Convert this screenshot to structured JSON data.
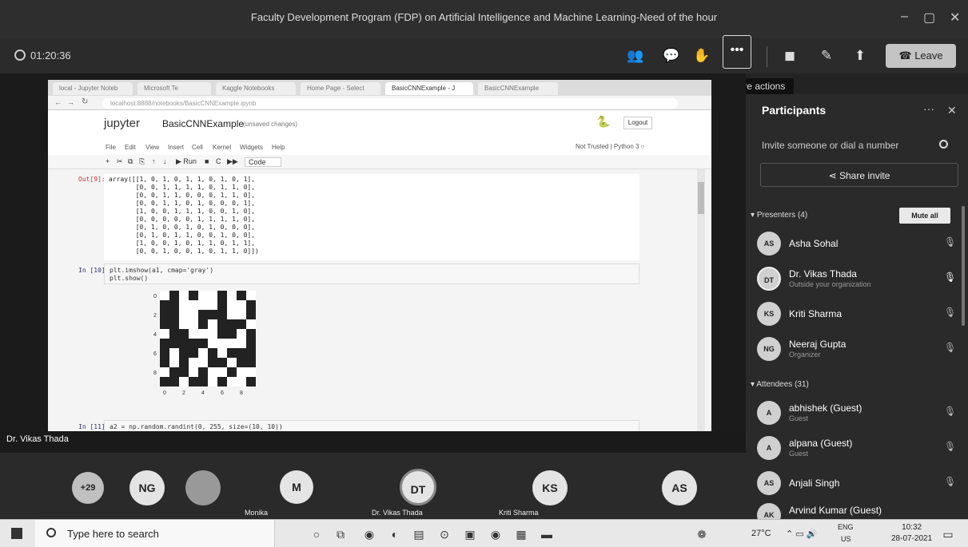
{
  "window": {
    "title": "Faculty Development Program (FDP) on Artificial Intelligence and Machine Learning-Need of the hour"
  },
  "meeting": {
    "timer": "01:20:36",
    "more_actions_tooltip": "More actions",
    "more_label": "•••",
    "leave_label": "Leave"
  },
  "browser": {
    "tabs": [
      "local - Jupyter Noteb",
      "Microsoft Te",
      "Kaggle Notebooks",
      "Home Page - Select",
      "BasicCNNExample - J",
      "BasicCNNExample"
    ],
    "url": "localhost:8888/notebooks/BasicCNNExample.ipynb",
    "notebook_name": "BasicCNNExample",
    "jupyter_label": "jupyter",
    "saved_state": "(unsaved changes)",
    "logout_label": "Logout",
    "menus": [
      "File",
      "Edit",
      "View",
      "Insert",
      "Cell",
      "Kernel",
      "Widgets",
      "Help"
    ],
    "kernel_info": "Not Trusted   |  Python 3 ○",
    "toolbar": [
      "+",
      "✂",
      "⧉",
      "⎘",
      "↑",
      "↓",
      "▶ Run",
      "■",
      "C",
      "▶▶",
      "Code"
    ],
    "out_prompt": "Out[9]:",
    "array_text": "array([[1, 0, 1, 0, 1, 1, 0, 1, 0, 1],\n       [0, 0, 1, 1, 1, 1, 0, 1, 1, 0],\n       [0, 0, 1, 1, 0, 0, 0, 1, 1, 0],\n       [0, 0, 1, 1, 0, 1, 0, 0, 0, 1],\n       [1, 0, 0, 1, 1, 1, 0, 0, 1, 0],\n       [0, 0, 0, 0, 0, 1, 1, 1, 1, 0],\n       [0, 1, 0, 0, 1, 0, 1, 0, 0, 0],\n       [0, 1, 0, 1, 1, 0, 0, 1, 0, 0],\n       [1, 0, 0, 1, 0, 1, 1, 0, 1, 1],\n       [0, 0, 1, 0, 0, 1, 0, 1, 1, 0]])",
    "in_prompt": "In [10]:",
    "code_cell": "plt.imshow(a1, cmap='gray')\nplt.show()",
    "in_prompt2": "In [11]:",
    "code_cell2": "a2 = np.random.randint(0, 255, size=(10, 10))",
    "image_ticks_x": [
      "0",
      "2",
      "4",
      "6",
      "8"
    ],
    "image_ticks_y": [
      "0",
      "2",
      "4",
      "6",
      "8"
    ]
  },
  "presenter_video_label": "Dr. Vikas Thada",
  "participants": {
    "title": "Participants",
    "invite_placeholder": "Invite someone or dial a number",
    "share_invite": "Share invite",
    "presenters_header": "Presenters (4)",
    "mute_all": "Mute all",
    "presenters": [
      {
        "initials": "AS",
        "name": "Asha Sohal",
        "sub": ""
      },
      {
        "initials": "DT",
        "name": "Dr. Vikas Thada",
        "sub": "Outside your organization"
      },
      {
        "initials": "KS",
        "name": "Kriti Sharma",
        "sub": ""
      },
      {
        "initials": "NG",
        "name": "Neeraj Gupta",
        "sub": "Organizer"
      }
    ],
    "attendees_header": "Attendees (31)",
    "attendees": [
      {
        "initials": "A",
        "name": "abhishek (Guest)",
        "sub": "Guest"
      },
      {
        "initials": "A",
        "name": "alpana (Guest)",
        "sub": "Guest"
      },
      {
        "initials": "AS",
        "name": "Anjali Singh",
        "sub": ""
      },
      {
        "initials": "AK",
        "name": "Arvind Kumar (Guest)",
        "sub": ""
      }
    ]
  },
  "video_strip": {
    "overflow": "+29",
    "tiles": [
      {
        "initials": "NG",
        "label": ""
      },
      {
        "initials": "M",
        "label": "Monika"
      },
      {
        "initials": "DT",
        "label": "Dr. Vikas Thada"
      },
      {
        "initials": "KS",
        "label": "Kriti Sharma"
      },
      {
        "initials": "AS",
        "label": ""
      }
    ]
  },
  "taskbar": {
    "search_placeholder": "Type here to search",
    "weather": "27°C",
    "lang_top": "ENG",
    "lang_bottom": "US",
    "time": "10:32",
    "date": "28-07-2021"
  },
  "matrix": [
    [
      1,
      0,
      1,
      0,
      1,
      1,
      0,
      1,
      0,
      1
    ],
    [
      0,
      0,
      1,
      1,
      1,
      1,
      0,
      1,
      1,
      0
    ],
    [
      0,
      0,
      1,
      1,
      0,
      0,
      0,
      1,
      1,
      0
    ],
    [
      0,
      0,
      1,
      1,
      0,
      1,
      0,
      0,
      0,
      1
    ],
    [
      1,
      0,
      0,
      1,
      1,
      1,
      0,
      0,
      1,
      0
    ],
    [
      0,
      0,
      0,
      0,
      0,
      1,
      1,
      1,
      1,
      0
    ],
    [
      0,
      1,
      0,
      0,
      1,
      0,
      1,
      0,
      0,
      0
    ],
    [
      0,
      1,
      0,
      1,
      1,
      0,
      0,
      1,
      0,
      0
    ],
    [
      1,
      0,
      0,
      1,
      0,
      1,
      1,
      0,
      1,
      1
    ],
    [
      0,
      0,
      1,
      0,
      0,
      1,
      0,
      1,
      1,
      0
    ]
  ]
}
